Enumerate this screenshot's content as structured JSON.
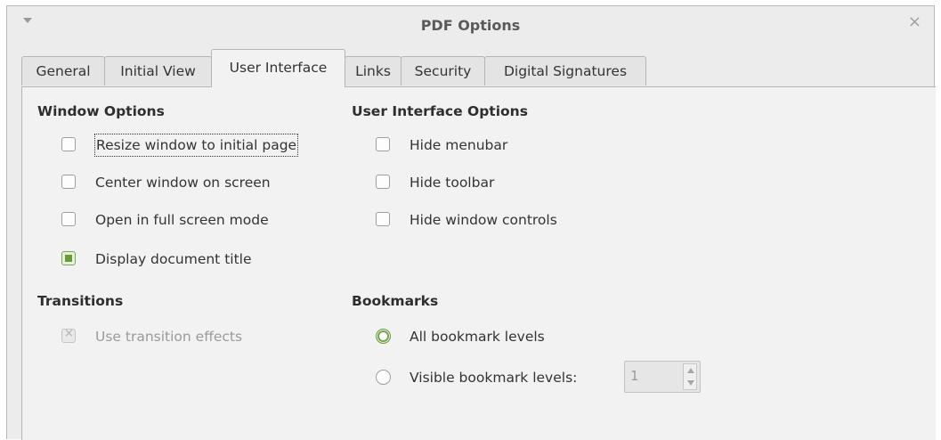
{
  "window": {
    "title": "PDF Options",
    "menu_icon": "chevron-down-icon",
    "close_icon": "close-icon",
    "close_glyph": "×"
  },
  "tabs": [
    {
      "label": "General",
      "active": false
    },
    {
      "label": "Initial View",
      "active": false
    },
    {
      "label": "User Interface",
      "active": true
    },
    {
      "label": "Links",
      "active": false
    },
    {
      "label": "Security",
      "active": false
    },
    {
      "label": "Digital Signatures",
      "active": false
    }
  ],
  "window_options": {
    "title": "Window Options",
    "items": [
      {
        "label": "Resize window to initial page",
        "checked": false,
        "focused": true
      },
      {
        "label": "Center window on screen",
        "checked": false
      },
      {
        "label": "Open in full screen mode",
        "checked": false
      },
      {
        "label": "Display document title",
        "checked": true
      }
    ]
  },
  "ui_options": {
    "title": "User Interface Options",
    "items": [
      {
        "label": "Hide menubar",
        "checked": false
      },
      {
        "label": "Hide toolbar",
        "checked": false
      },
      {
        "label": "Hide window controls",
        "checked": false
      }
    ]
  },
  "transitions": {
    "title": "Transitions",
    "items": [
      {
        "label": "Use transition effects",
        "checked": true,
        "disabled": true
      }
    ]
  },
  "bookmarks": {
    "title": "Bookmarks",
    "options": [
      {
        "label": "All bookmark levels",
        "selected": true
      },
      {
        "label": "Visible bookmark levels:",
        "selected": false
      }
    ],
    "level_value": "1"
  },
  "colors": {
    "accent": "#6a9a3c",
    "panel_bg": "#f2f2f2",
    "window_bg": "#ececec"
  }
}
